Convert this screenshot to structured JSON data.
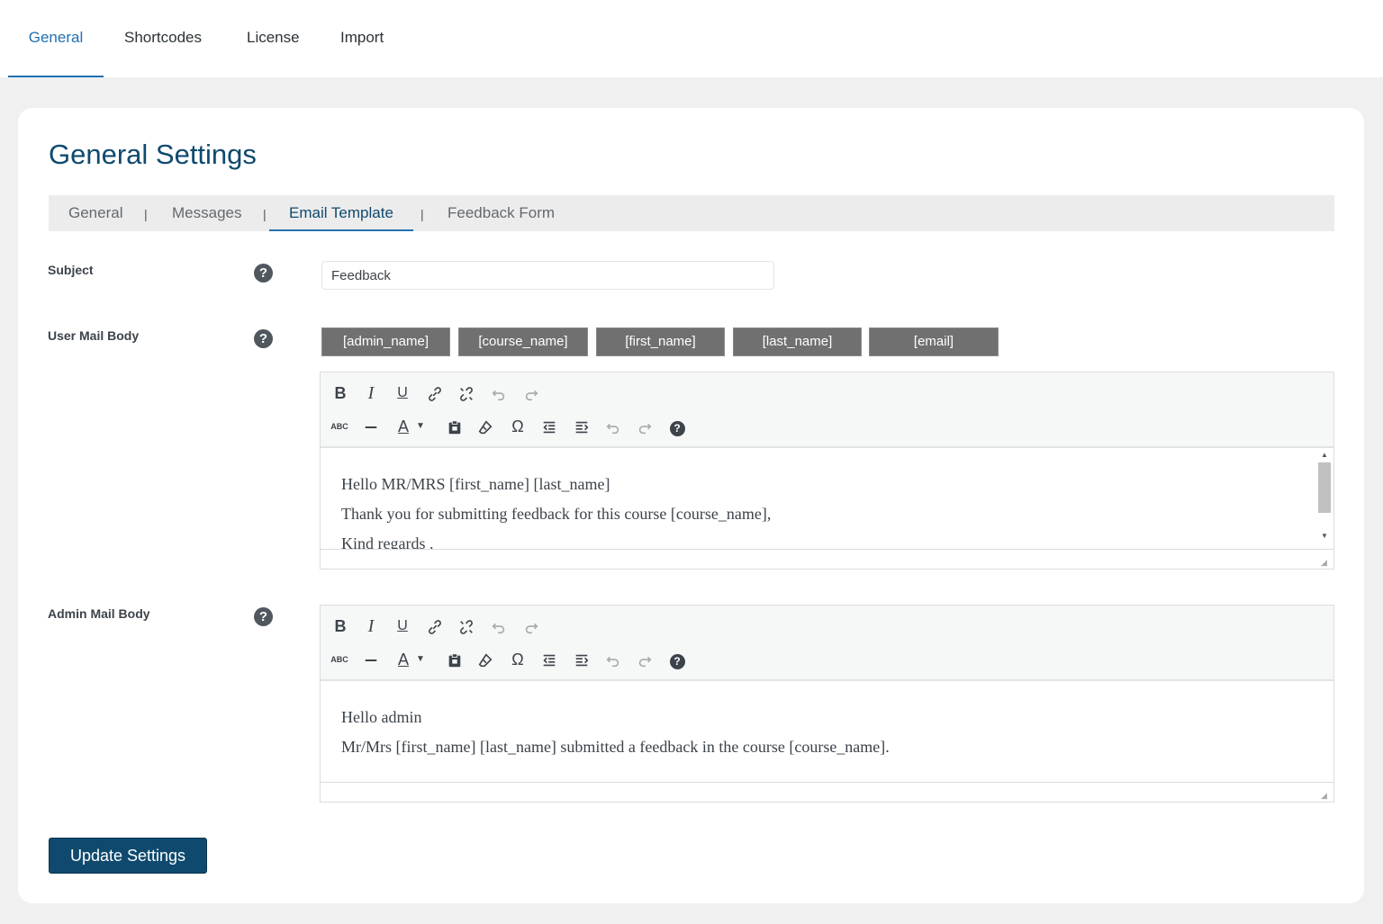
{
  "top_tabs": [
    {
      "label": "General",
      "active": true
    },
    {
      "label": "Shortcodes"
    },
    {
      "label": "License"
    },
    {
      "label": "Import"
    }
  ],
  "page_title": "General Settings",
  "sub_tabs": {
    "items": [
      "General",
      "Messages",
      "Email Template",
      "Feedback Form"
    ],
    "active": "Email Template",
    "separator": "|"
  },
  "subject": {
    "label": "Subject",
    "value": "Feedback",
    "help": "?"
  },
  "user_mail": {
    "label": "User Mail Body",
    "help": "?",
    "tags": [
      "[admin_name]",
      "[course_name]",
      "[first_name]",
      "[last_name]",
      "[email]"
    ],
    "lines": [
      "Hello MR/MRS [first_name] [last_name]",
      "Thank you for submitting feedback for this course [course_name],",
      "Kind regards ."
    ]
  },
  "admin_mail": {
    "label": "Admin Mail Body",
    "help": "?",
    "lines": [
      "Hello admin",
      "Mr/Mrs [first_name] [last_name] submitted a feedback in the course [course_name]."
    ]
  },
  "toolbar": {
    "bold": "B",
    "italic": "I",
    "underline": "U",
    "strikethrough": "ABC",
    "text_color": "A",
    "special_char": "Ω",
    "help": "?",
    "icons": [
      "bold-icon",
      "italic-icon",
      "underline-icon",
      "link-icon",
      "unlink-icon",
      "undo-icon",
      "redo-icon",
      "strikethrough-icon",
      "horizontal-line-icon",
      "text-color-icon",
      "paste-text-icon",
      "clear-formatting-icon",
      "special-character-icon",
      "outdent-icon",
      "indent-icon",
      "undo-icon",
      "redo-icon",
      "keyboard-shortcuts-icon"
    ]
  },
  "update_button": "Update Settings",
  "colors": {
    "accent": "#2271b1",
    "title": "#0f4a6e",
    "tag_button": "#707070",
    "primary_button": "#0f4a6e"
  }
}
